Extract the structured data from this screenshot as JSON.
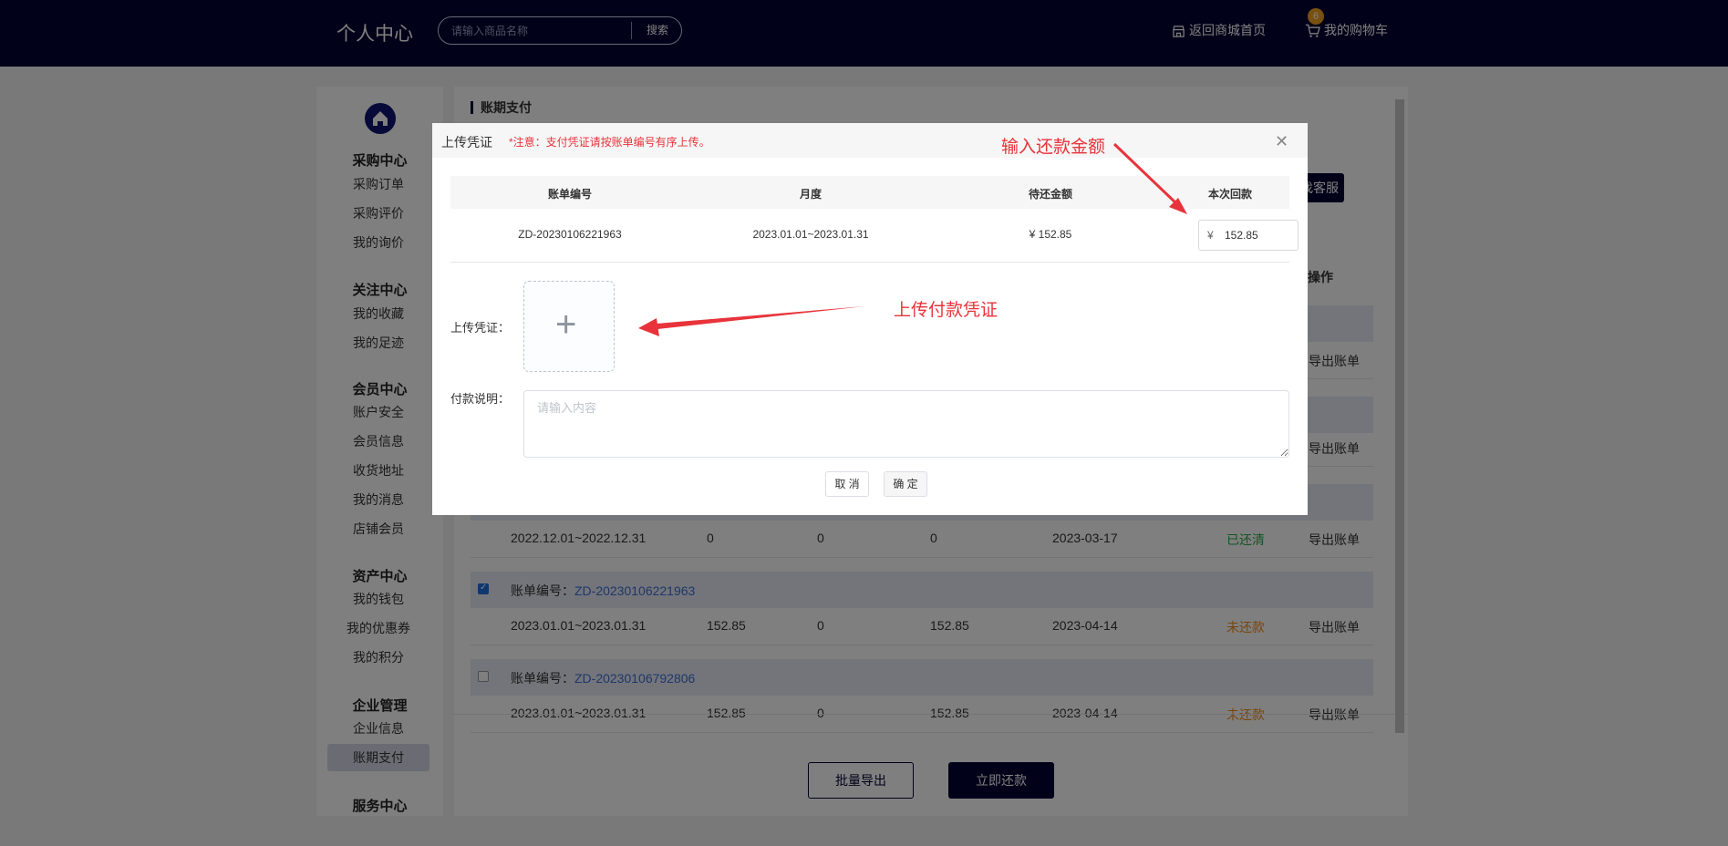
{
  "header": {
    "brand": "个人中心",
    "search_placeholder": "请输入商品名称",
    "search_button": "搜索",
    "nav_home": "返回商城首页",
    "nav_cart": "我的购物车",
    "cart_count": "6"
  },
  "sidebar": {
    "groups": [
      {
        "title": "采购中心",
        "items": [
          "采购订单",
          "采购评价",
          "我的询价"
        ]
      },
      {
        "title": "关注中心",
        "items": [
          "我的收藏",
          "我的足迹"
        ]
      },
      {
        "title": "会员中心",
        "items": [
          "账户安全",
          "会员信息",
          "收货地址",
          "我的消息",
          "店铺会员"
        ]
      },
      {
        "title": "资产中心",
        "items": [
          "我的钱包",
          "我的优惠券",
          "我的积分"
        ]
      },
      {
        "title": "企业管理",
        "items": [
          "企业信息",
          "账期支付"
        ]
      },
      {
        "title": "服务中心",
        "items": []
      }
    ],
    "active_item": "账期支付"
  },
  "main": {
    "title": "账期支付",
    "kefu_button": "找客服",
    "col_operation": "操作",
    "export_link": "导出账单",
    "bill_label": "账单编号：",
    "rows_visible_top": [
      {
        "op": "导出账单"
      },
      {
        "op": "导出账单"
      }
    ],
    "bills": [
      {
        "head": null,
        "checked": null,
        "row": {
          "period": "2022.12.01~2022.12.31",
          "amount": "0",
          "paid": "0",
          "remaining": "0",
          "due": "2023-03-17",
          "status": "已还清",
          "status_type": "green"
        }
      },
      {
        "head": "ZD-20230106221963",
        "checked": true,
        "row": {
          "period": "2023.01.01~2023.01.31",
          "amount": "152.85",
          "paid": "0",
          "remaining": "152.85",
          "due": "2023-04-14",
          "status": "未还款",
          "status_type": "orange"
        }
      },
      {
        "head": "ZD-20230106792806",
        "checked": false,
        "row": {
          "period": "2023.01.01~2023.01.31",
          "amount": "152.85",
          "paid": "0",
          "remaining": "152.85",
          "due": "2023-04-14",
          "status": "未还款",
          "status_type": "orange"
        }
      }
    ],
    "btn_export": "批量导出",
    "btn_pay": "立即还款"
  },
  "modal": {
    "title": "上传凭证",
    "note": "*注意：支付凭证请按账单编号有序上传。",
    "table_headers": [
      "账单编号",
      "月度",
      "待还金额",
      "本次回款"
    ],
    "row": {
      "bill_no": "ZD-20230106221963",
      "month": "2023.01.01~2023.01.31",
      "due_amount": "¥ 152.85",
      "currency": "¥",
      "repay_amount": "152.85"
    },
    "upload_label": "上传凭证：",
    "desc_label": "付款说明：",
    "desc_placeholder": "请输入内容",
    "btn_cancel": "取 消",
    "btn_ok": "确 定"
  },
  "annotations": {
    "amount": "输入还款金额",
    "voucher": "上传付款凭证",
    "color": "#e8333a"
  },
  "colors": {
    "header_bg": "#020233",
    "accent": "#020233",
    "paid_green": "#2aa84a",
    "unpaid_orange": "#f08a1c",
    "link_blue": "#3b6fd6"
  }
}
